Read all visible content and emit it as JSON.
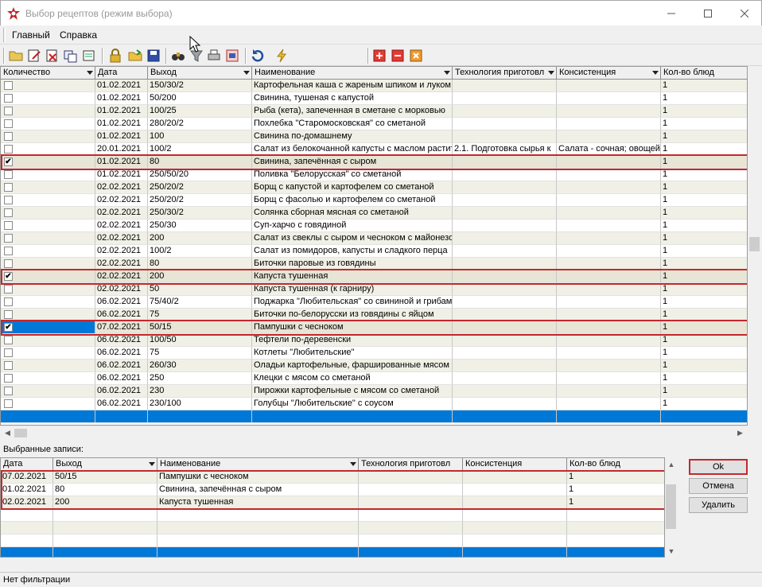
{
  "window": {
    "title": "Выбор рецептов (режим выбора)"
  },
  "menu": [
    "Главный",
    "Справка"
  ],
  "main_grid": {
    "columns": [
      "Количество",
      "Дата",
      "Выход",
      "Наименование",
      "Технология приготовл",
      "Консистенция",
      "Кол-во блюд"
    ],
    "rows": [
      {
        "checked": false,
        "date": "01.02.2021",
        "out": "150/30/2",
        "name": "Картофельная каша с жареным шпиком и луком",
        "tech": "",
        "cons": "",
        "qty": "1"
      },
      {
        "checked": false,
        "date": "01.02.2021",
        "out": "50/200",
        "name": "Свинина, тушеная с капустой",
        "tech": "",
        "cons": "",
        "qty": "1"
      },
      {
        "checked": false,
        "date": "01.02.2021",
        "out": "100/25",
        "name": "Рыба (кета), запеченная в сметане с морковью",
        "tech": "",
        "cons": "",
        "qty": "1"
      },
      {
        "checked": false,
        "date": "01.02.2021",
        "out": "280/20/2",
        "name": "Похлебка \"Старомосковская\" со сметаной",
        "tech": "",
        "cons": "",
        "qty": "1"
      },
      {
        "checked": false,
        "date": "01.02.2021",
        "out": "100",
        "name": "Свинина по-домашнему",
        "tech": "",
        "cons": "",
        "qty": "1"
      },
      {
        "checked": false,
        "date": "20.01.2021",
        "out": "100/2",
        "name": "Салат из белокочанной капусты с маслом растит",
        "tech": "2.1. Подготовка сырья к",
        "cons": "Салата - сочная; овощей",
        "qty": "1"
      },
      {
        "checked": true,
        "date": "01.02.2021",
        "out": "80",
        "name": "Свинина, запечённая с сыром",
        "tech": "",
        "cons": "",
        "qty": "1"
      },
      {
        "checked": false,
        "date": "01.02.2021",
        "out": "250/50/20",
        "name": "Поливка \"Белорусская\" со сметаной",
        "tech": "",
        "cons": "",
        "qty": "1"
      },
      {
        "checked": false,
        "date": "02.02.2021",
        "out": "250/20/2",
        "name": "Борщ с капустой и картофелем со сметаной",
        "tech": "",
        "cons": "",
        "qty": "1"
      },
      {
        "checked": false,
        "date": "02.02.2021",
        "out": "250/20/2",
        "name": "Борщ с фасолью и картофелем со сметаной",
        "tech": "",
        "cons": "",
        "qty": "1"
      },
      {
        "checked": false,
        "date": "02.02.2021",
        "out": "250/30/2",
        "name": "Солянка сборная мясная со сметаной",
        "tech": "",
        "cons": "",
        "qty": "1"
      },
      {
        "checked": false,
        "date": "02.02.2021",
        "out": "250/30",
        "name": "Суп-харчо с говядиной",
        "tech": "",
        "cons": "",
        "qty": "1"
      },
      {
        "checked": false,
        "date": "02.02.2021",
        "out": "200",
        "name": "Салат из свеклы с сыром и чесноком с майонезом",
        "tech": "",
        "cons": "",
        "qty": "1"
      },
      {
        "checked": false,
        "date": "02.02.2021",
        "out": "100/2",
        "name": "Салат из помидоров, капусты и сладкого перца",
        "tech": "",
        "cons": "",
        "qty": "1"
      },
      {
        "checked": false,
        "date": "02.02.2021",
        "out": "80",
        "name": "Биточки паровые из говядины",
        "tech": "",
        "cons": "",
        "qty": "1"
      },
      {
        "checked": true,
        "date": "02.02.2021",
        "out": "200",
        "name": "Капуста тушенная",
        "tech": "",
        "cons": "",
        "qty": "1"
      },
      {
        "checked": false,
        "date": "02.02.2021",
        "out": "50",
        "name": "Капуста тушенная (к гарниру)",
        "tech": "",
        "cons": "",
        "qty": "1"
      },
      {
        "checked": false,
        "date": "06.02.2021",
        "out": "75/40/2",
        "name": "Поджарка \"Любительская\" со свининой и грибам",
        "tech": "",
        "cons": "",
        "qty": "1"
      },
      {
        "checked": false,
        "date": "06.02.2021",
        "out": "75",
        "name": "Биточки по-белорусски из говядины с яйцом",
        "tech": "",
        "cons": "",
        "qty": "1"
      },
      {
        "checked": true,
        "date": "07.02.2021",
        "out": "50/15",
        "name": "Пампушки с чесноком",
        "tech": "",
        "cons": "",
        "qty": "1"
      },
      {
        "checked": false,
        "date": "06.02.2021",
        "out": "100/50",
        "name": "Тефтели по-деревенски",
        "tech": "",
        "cons": "",
        "qty": "1"
      },
      {
        "checked": false,
        "date": "06.02.2021",
        "out": "75",
        "name": "Котлеты \"Любительские\"",
        "tech": "",
        "cons": "",
        "qty": "1"
      },
      {
        "checked": false,
        "date": "06.02.2021",
        "out": "260/30",
        "name": "Оладьи картофельные, фаршированные мясом п",
        "tech": "",
        "cons": "",
        "qty": "1"
      },
      {
        "checked": false,
        "date": "06.02.2021",
        "out": "250",
        "name": "Клецки с мясом со сметаной",
        "tech": "",
        "cons": "",
        "qty": "1"
      },
      {
        "checked": false,
        "date": "06.02.2021",
        "out": "230",
        "name": "Пирожки картофельные с мясом со сметаной",
        "tech": "",
        "cons": "",
        "qty": "1"
      },
      {
        "checked": false,
        "date": "06.02.2021",
        "out": "230/100",
        "name": "Голубцы \"Любительские\" с соусом",
        "tech": "",
        "cons": "",
        "qty": "1"
      }
    ]
  },
  "selected_label": "Выбранные записи:",
  "selected_grid": {
    "columns": [
      "Дата",
      "Выход",
      "Наименование",
      "Технология приготовл",
      "Консистенция",
      "Кол-во блюд"
    ],
    "rows": [
      {
        "date": "07.02.2021",
        "out": "50/15",
        "name": "Пампушки с чесноком",
        "tech": "",
        "cons": "",
        "qty": "1"
      },
      {
        "date": "01.02.2021",
        "out": "80",
        "name": "Свинина, запечённая с сыром",
        "tech": "",
        "cons": "",
        "qty": "1"
      },
      {
        "date": "02.02.2021",
        "out": "200",
        "name": "Капуста тушенная",
        "tech": "",
        "cons": "",
        "qty": "1"
      }
    ]
  },
  "buttons": {
    "ok": "Ok",
    "cancel": "Отмена",
    "delete": "Удалить"
  },
  "status": "Нет фильтрации",
  "colors": {
    "highlight": "#c4282e",
    "selection": "#0078d7",
    "alt_row": "#f0f0e6"
  }
}
